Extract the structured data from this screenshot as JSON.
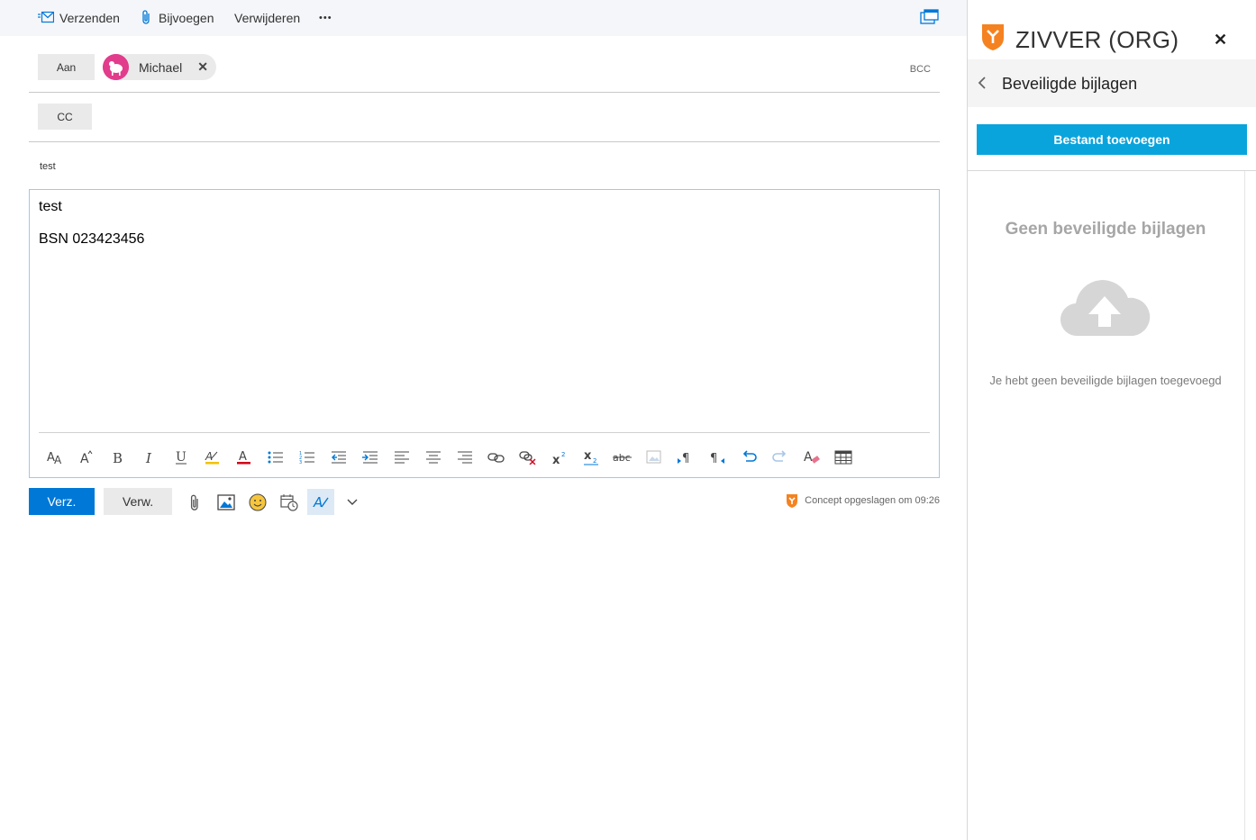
{
  "toolbar": {
    "send_label": "Verzenden",
    "attach_label": "Bijvoegen",
    "delete_label": "Verwijderen",
    "more_label": "•••"
  },
  "recipients": {
    "to_label": "Aan",
    "cc_label": "CC",
    "bcc_label": "BCC",
    "to": [
      {
        "name": "Michael"
      }
    ]
  },
  "subject": "test",
  "body": {
    "lines": [
      "test",
      "BSN 023423456"
    ]
  },
  "format_toolbar": {
    "items": [
      "font-size-icon",
      "grow-font-icon",
      "bold-icon",
      "italic-icon",
      "underline-icon",
      "highlight-icon",
      "font-color-icon",
      "bullets-icon",
      "numbering-icon",
      "decrease-indent-icon",
      "increase-indent-icon",
      "align-left-icon",
      "align-center-icon",
      "align-right-icon",
      "link-icon",
      "remove-link-icon",
      "superscript-icon",
      "subscript-icon",
      "strikethrough-icon",
      "insert-image-icon",
      "ltr-icon",
      "rtl-icon",
      "undo-icon",
      "redo-icon",
      "clear-format-icon",
      "table-icon"
    ]
  },
  "actions": {
    "send_label": "Verz.",
    "discard_label": "Verw.",
    "status": "Concept opgeslagen om 09:26"
  },
  "panel": {
    "title": "ZIVVER (ORG)",
    "section_title": "Beveiligde bijlagen",
    "add_button": "Bestand toevoegen",
    "empty_title": "Geen beveiligde bijlagen",
    "empty_message": "Je hebt geen beveiligde bijlagen toegevoegd"
  },
  "colors": {
    "accent": "#0078d7",
    "panel_button": "#0aa4dd",
    "brand_orange": "#f58220"
  }
}
